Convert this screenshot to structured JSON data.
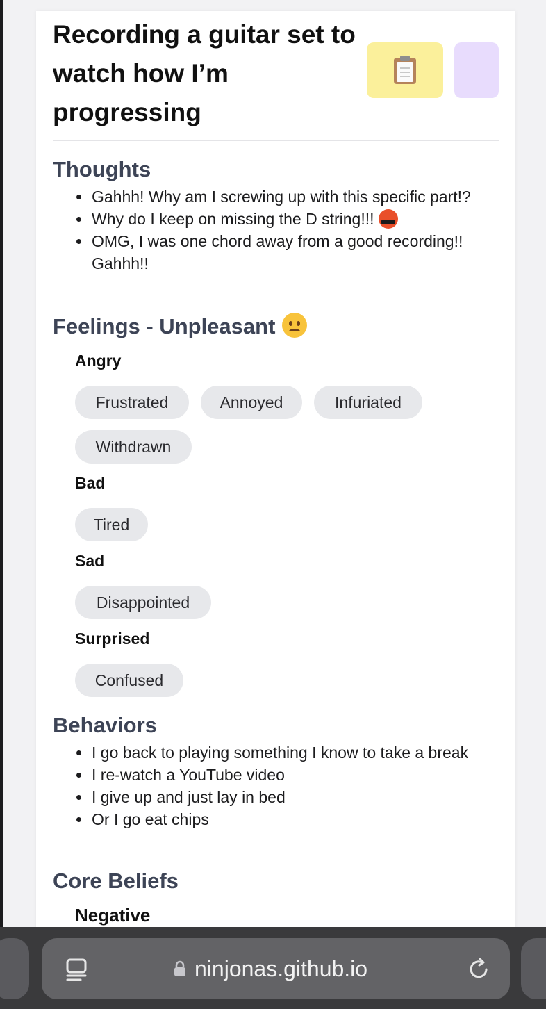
{
  "entry": {
    "title": "Recording a guitar set to watch how I’m progressing",
    "tiles": [
      {
        "name": "clipboard-tile",
        "color": "#fbf09b",
        "icon": "clipboard-icon"
      },
      {
        "name": "color-tile",
        "color": "#e8dcfd"
      }
    ]
  },
  "thoughts": {
    "heading": "Thoughts",
    "items": [
      "Gahhh! Why am I screwing up with this specific part!?",
      "Why do I keep on missing the D string!!!",
      "OMG, I was one chord away from a good recording!! Gahhh!!"
    ],
    "item2_emoji": "face-with-symbols-on-mouth-icon"
  },
  "feelings": {
    "heading": "Feelings - Unpleasant",
    "heading_emoji": "frowning-face-icon",
    "groups": [
      {
        "label": "Angry",
        "chips": [
          "Frustrated",
          "Annoyed",
          "Infuriated",
          "Withdrawn"
        ]
      },
      {
        "label": "Bad",
        "chips": [
          "Tired"
        ]
      },
      {
        "label": "Sad",
        "chips": [
          "Disappointed"
        ]
      },
      {
        "label": "Surprised",
        "chips": [
          "Confused"
        ]
      }
    ]
  },
  "behaviors": {
    "heading": "Behaviors",
    "items": [
      "I go back to playing something I know to take a break",
      "I re-watch a YouTube video",
      "I give up and just lay in bed",
      "Or I go eat chips"
    ]
  },
  "core_beliefs": {
    "heading": "Core Beliefs",
    "subheading": "Negative"
  },
  "browser": {
    "url": "ninjonas.github.io",
    "tabs_icon": "tabs-icon",
    "lock_icon": "lock-icon",
    "reload_icon": "reload-icon"
  },
  "colors": {
    "heading": "#3d4456",
    "chip_bg": "#e7e8eb",
    "bar_bg": "#3a3a3c"
  }
}
